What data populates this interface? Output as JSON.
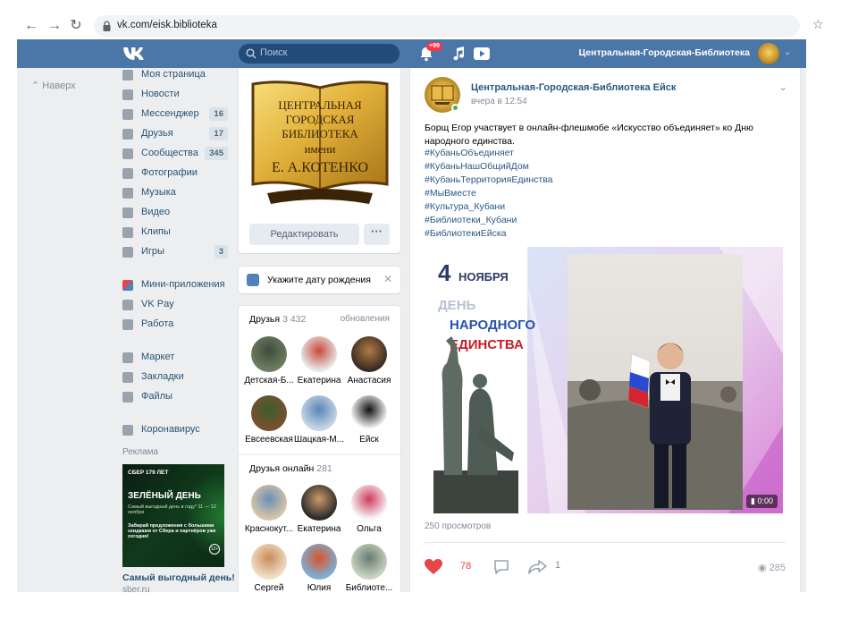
{
  "browser": {
    "url": "vk.com/eisk.biblioteka"
  },
  "header": {
    "search_placeholder": "Поиск",
    "notifications_badge": "+99",
    "profile_name": "Центральная-Городская-Библиотека"
  },
  "sidebar": {
    "back_label": "Наверх",
    "items": [
      {
        "label": "Моя страница",
        "badge": ""
      },
      {
        "label": "Новости",
        "badge": ""
      },
      {
        "label": "Мессенджер",
        "badge": "16"
      },
      {
        "label": "Друзья",
        "badge": "17"
      },
      {
        "label": "Сообщества",
        "badge": "345"
      },
      {
        "label": "Фотографии",
        "badge": ""
      },
      {
        "label": "Музыка",
        "badge": ""
      },
      {
        "label": "Видео",
        "badge": ""
      },
      {
        "label": "Клипы",
        "badge": ""
      },
      {
        "label": "Игры",
        "badge": "3"
      },
      {
        "label": "Мини-приложения",
        "badge": ""
      },
      {
        "label": "VK Pay",
        "badge": ""
      },
      {
        "label": "Работа",
        "badge": ""
      },
      {
        "label": "Маркет",
        "badge": ""
      },
      {
        "label": "Закладки",
        "badge": ""
      },
      {
        "label": "Файлы",
        "badge": ""
      },
      {
        "label": "Коронавирус",
        "badge": ""
      }
    ],
    "ads_label": "Реклама",
    "ad": {
      "brand_line": "СБЕР 179 ЛЕТ",
      "headline": "ЗЕЛЁНЫЙ ДЕНЬ",
      "subline": "Самый выгодный день в году* 11 — 12 ноября",
      "offer": "Забирай предложения с большими скидками от Сбера и партнёров уже сегодня!",
      "age": "12+",
      "title": "Самый выгодный день!",
      "domain": "sber.ru"
    }
  },
  "cover": {
    "line1": "ЦЕНТРАЛЬНАЯ",
    "line2": "ГОРОДСКАЯ",
    "line3": "БИБЛИОТЕКА",
    "line4": "имени",
    "line5": "Е. А.КОТЕНКО",
    "edit_label": "Редактировать",
    "more_label": "···"
  },
  "birthday": {
    "text": "Укажите дату рождения"
  },
  "friends": {
    "title": "Друзья",
    "count": "3 432",
    "link": "обновления",
    "items": [
      {
        "name": "Детская-Б..."
      },
      {
        "name": "Екатерина"
      },
      {
        "name": "Анастасия"
      },
      {
        "name": "Евсеевская"
      },
      {
        "name": "Шацкая-М..."
      },
      {
        "name": "Ейск"
      }
    ]
  },
  "friends_online": {
    "title": "Друзья онлайн",
    "count": "281",
    "items": [
      {
        "name": "Краснокут..."
      },
      {
        "name": "Екатерина"
      },
      {
        "name": "Ольга"
      },
      {
        "name": "Сергей"
      },
      {
        "name": "Юлия"
      },
      {
        "name": "Библиоте..."
      }
    ]
  },
  "post": {
    "author": "Центральная-Городская-Библиотека Ейск",
    "time": "вчера в 12:54",
    "text": "Борщ Егор участвует в онлайн-флешмобе «Искусство объединяет» ко Дню народного единства.",
    "hashtags": [
      "#КубаньОбъединяет",
      "#КубаньНашОбщийДом",
      "#КубаньТерриторияЕдинства",
      "#МыВместе",
      "#Культура_Кубани",
      "#Библиотеки_Кубани",
      "#БиблиотекиЕйска"
    ],
    "media": {
      "date_number": "4",
      "date_month": "НОЯБРЯ",
      "day_word": "ДЕНЬ",
      "title_line1": "НАРОДНОГО",
      "title_line2": "ЕДИНСТВА",
      "duration": "0:00"
    },
    "views_line": "250 просмотров",
    "likes": "78",
    "shares": "1",
    "views": "285"
  },
  "colors": {
    "vk_blue": "#4a76a8",
    "link": "#2a5885",
    "like": "#e64646",
    "page_bg": "#edeef0"
  }
}
